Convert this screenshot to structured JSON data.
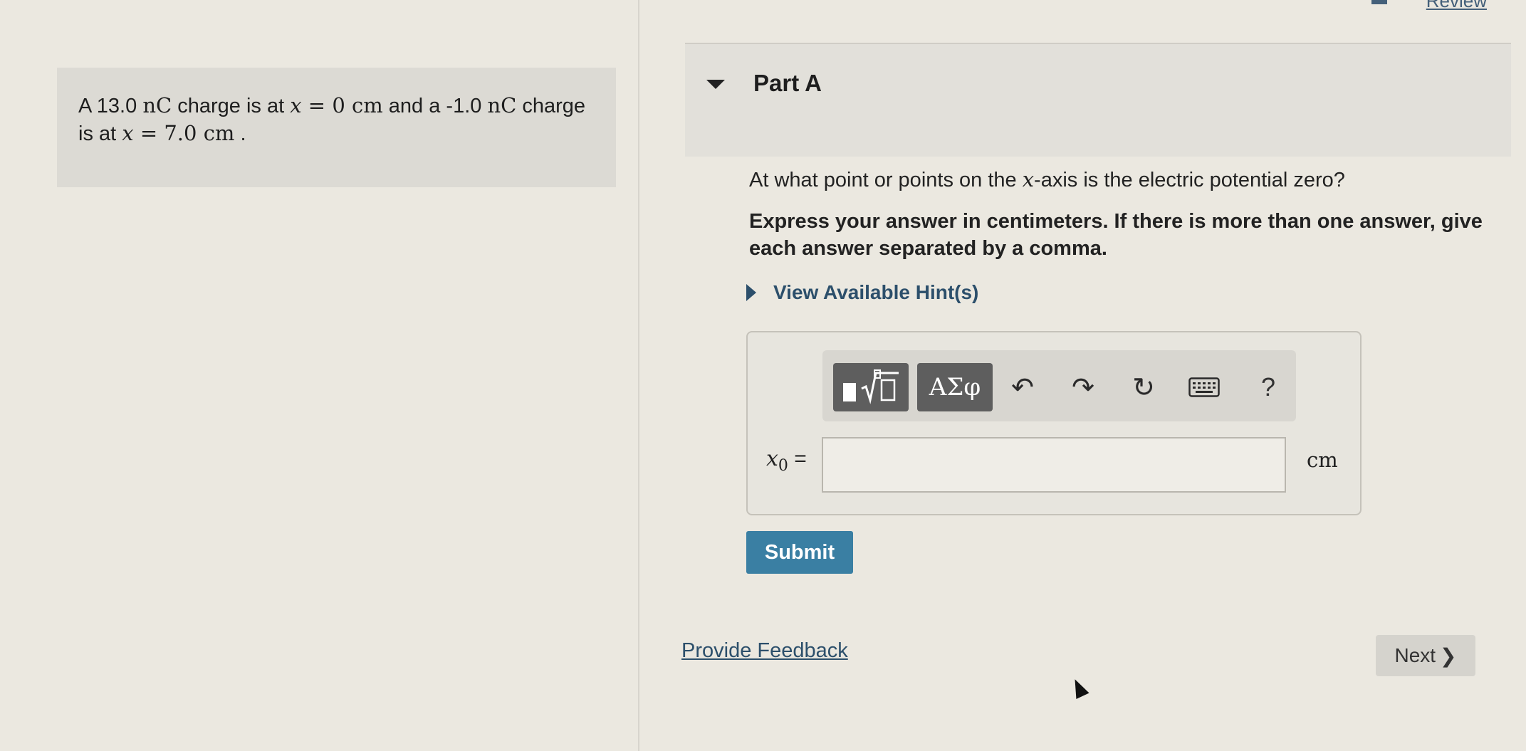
{
  "header": {
    "review_label": "Review"
  },
  "problem": {
    "segments": [
      {
        "text": "A 13.0 ",
        "style": "text"
      },
      {
        "text": "nC",
        "style": "math"
      },
      {
        "text": " charge is at ",
        "style": "text"
      },
      {
        "text": "x",
        "style": "var"
      },
      {
        "text": " = 0 ",
        "style": "math"
      },
      {
        "text": "cm",
        "style": "math"
      },
      {
        "text": " and a -1.0 ",
        "style": "text"
      },
      {
        "text": "nC",
        "style": "math"
      },
      {
        "text": " charge is at ",
        "style": "text"
      },
      {
        "text": "x",
        "style": "var"
      },
      {
        "text": " = 7.0 ",
        "style": "math"
      },
      {
        "text": "cm",
        "style": "math"
      },
      {
        "text": " .",
        "style": "text"
      }
    ]
  },
  "part": {
    "title": "Part A",
    "question_before": "At what point or points on the ",
    "question_var": "x",
    "question_after": "-axis is the electric potential zero?",
    "instructions": "Express your answer in centimeters. If there is more than one answer, give each answer separated by a comma.",
    "hint_label": "View Available Hint(s)"
  },
  "toolbar": {
    "greek_label": "ΑΣφ",
    "undo_icon": "↶",
    "redo_icon": "↷",
    "reset_icon": "↻",
    "help_label": "?"
  },
  "answer": {
    "variable": "x",
    "subscript": "0",
    "equals": "=",
    "value": "",
    "unit": "cm"
  },
  "actions": {
    "submit_label": "Submit",
    "feedback_label": "Provide Feedback",
    "next_label": "Next",
    "next_chevron": "❯"
  },
  "colors": {
    "background": "#ebe8e0",
    "submit": "#3a7fa3",
    "link": "#2c4f6b"
  }
}
